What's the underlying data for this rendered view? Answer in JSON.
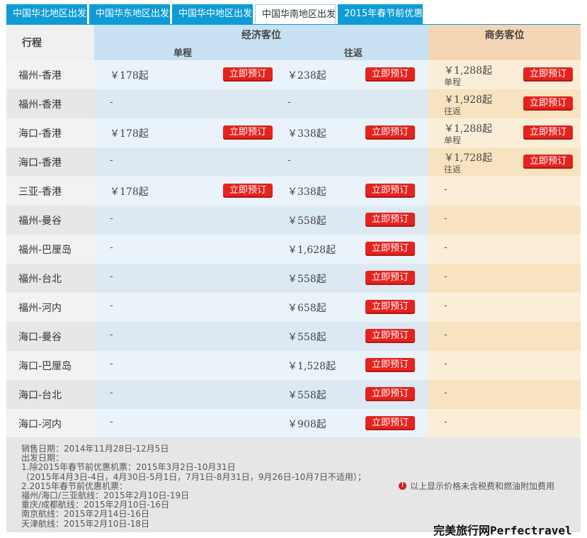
{
  "tabs": [
    {
      "label": "中国华北地区出发",
      "active": false
    },
    {
      "label": "中国华东地区出发",
      "active": false
    },
    {
      "label": "中国华中地区出发",
      "active": false
    },
    {
      "label": "中国华南地区出发",
      "active": true
    },
    {
      "label": "2015年春节前优惠",
      "active": false
    }
  ],
  "header": {
    "route": "行程",
    "economy": "经济客位",
    "one_way": "单程",
    "round_trip": "往返",
    "business": "商务客位"
  },
  "book_label": "立即预订",
  "rows": [
    {
      "route": "福州-香港",
      "ow": "￥178起",
      "rt": "￥238起",
      "bus": "￥1,288起",
      "bus_sub": "单程"
    },
    {
      "route": "福州-香港",
      "ow": "-",
      "rt": "-",
      "bus": "￥1,928起",
      "bus_sub": "往返"
    },
    {
      "route": "海口-香港",
      "ow": "￥178起",
      "rt": "￥338起",
      "bus": "￥1,288起",
      "bus_sub": "单程"
    },
    {
      "route": "海口-香港",
      "ow": "-",
      "rt": "-",
      "bus": "￥1,728起",
      "bus_sub": "往返"
    },
    {
      "route": "三亚-香港",
      "ow": "￥178起",
      "rt": "￥338起",
      "bus": "-",
      "bus_sub": ""
    },
    {
      "route": "福州-曼谷",
      "ow": "-",
      "rt": "￥558起",
      "bus": "-",
      "bus_sub": ""
    },
    {
      "route": "福州-巴厘岛",
      "ow": "-",
      "rt": "￥1,628起",
      "bus": "-",
      "bus_sub": ""
    },
    {
      "route": "福州-台北",
      "ow": "-",
      "rt": "￥558起",
      "bus": "-",
      "bus_sub": ""
    },
    {
      "route": "福州-河内",
      "ow": "-",
      "rt": "￥658起",
      "bus": "-",
      "bus_sub": ""
    },
    {
      "route": "海口-曼谷",
      "ow": "-",
      "rt": "￥558起",
      "bus": "-",
      "bus_sub": ""
    },
    {
      "route": "海口-巴厘岛",
      "ow": "-",
      "rt": "￥1,528起",
      "bus": "-",
      "bus_sub": ""
    },
    {
      "route": "海口-台北",
      "ow": "-",
      "rt": "￥558起",
      "bus": "-",
      "bus_sub": ""
    },
    {
      "route": "海口-河内",
      "ow": "-",
      "rt": "￥908起",
      "bus": "-",
      "bus_sub": ""
    }
  ],
  "notes": [
    "销售日期：2014年11月28日-12月5日",
    "出发日期：",
    "1.除2015年春节前优惠机票：2015年3月2日-10月31日",
    "（2015年4月3日-4日，4月30日-5月1日，7月1日-8月31日，9月26日-10月7日不适用）；",
    "2.2015年春节前优惠机票：",
    "福州/海口/三亚航线：2015年2月10日-19日",
    "重庆/成都航线：2015年2月10日-16日",
    "南京航线：2015年2月14日-16日",
    "天津航线：2015年2月10日-18日"
  ],
  "tip": "以上显示价格未含税费和燃油附加费用",
  "tip_icon": "alert-icon",
  "brand": "完美旅行网Perfectravel",
  "colors": {
    "tab": "#0e9bd6",
    "button": "#e4231f",
    "economy_header": "#c8e2f4",
    "business_header": "#f5d6b4"
  }
}
